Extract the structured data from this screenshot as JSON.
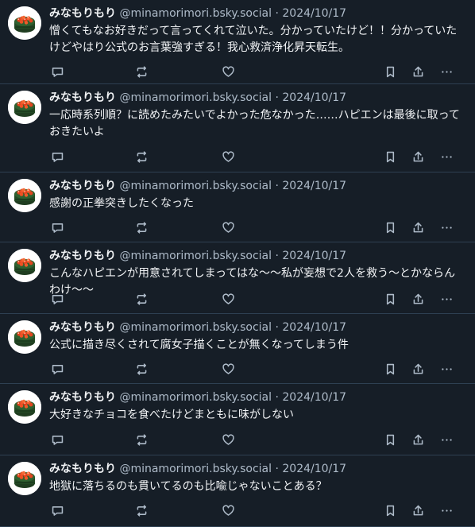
{
  "author": {
    "name": "みなもりもり",
    "handle": "@minamorimori.bsky.social"
  },
  "posts": [
    {
      "date": "· 2024/10/17",
      "text": "憎くてもなお好きだって言ってくれて泣いた。分かっていたけど！！分かっていたけどやはり公式のお言葉強すぎる！我心救済浄化昇天転生。"
    },
    {
      "date": "· 2024/10/17",
      "text": "一応時系列順？に読めたみたいでよかった危なかった……ハピエンは最後に取っておきたいよ"
    },
    {
      "date": "· 2024/10/17",
      "text": "感謝の正拳突きしたくなった"
    },
    {
      "date": "· 2024/10/17",
      "text": "こんなハピエンが用意されてしまってはな〜〜私が妄想で2人を救う〜とかならんわけ〜〜"
    },
    {
      "date": "· 2024/10/17",
      "text": "公式に描き尽くされて腐女子描くことが無くなってしまう件"
    },
    {
      "date": "· 2024/10/17",
      "text": "大好きなチョコを食べたけどまともに味がしない"
    },
    {
      "date": "· 2024/10/17",
      "text": "地獄に落ちるのも貫いてるのも比喩じゃないことある？"
    }
  ],
  "icons": {
    "avatar": "salmon-roe-sushi-avatar",
    "reply": "reply-icon",
    "repost": "repost-icon",
    "like": "heart-icon",
    "bookmark": "bookmark-icon",
    "share": "share-icon",
    "more": "more-icon"
  },
  "colors": {
    "background": "#161e27",
    "divider": "#2e4052",
    "muted": "#aebbc9",
    "text": "#f1f3f5"
  }
}
